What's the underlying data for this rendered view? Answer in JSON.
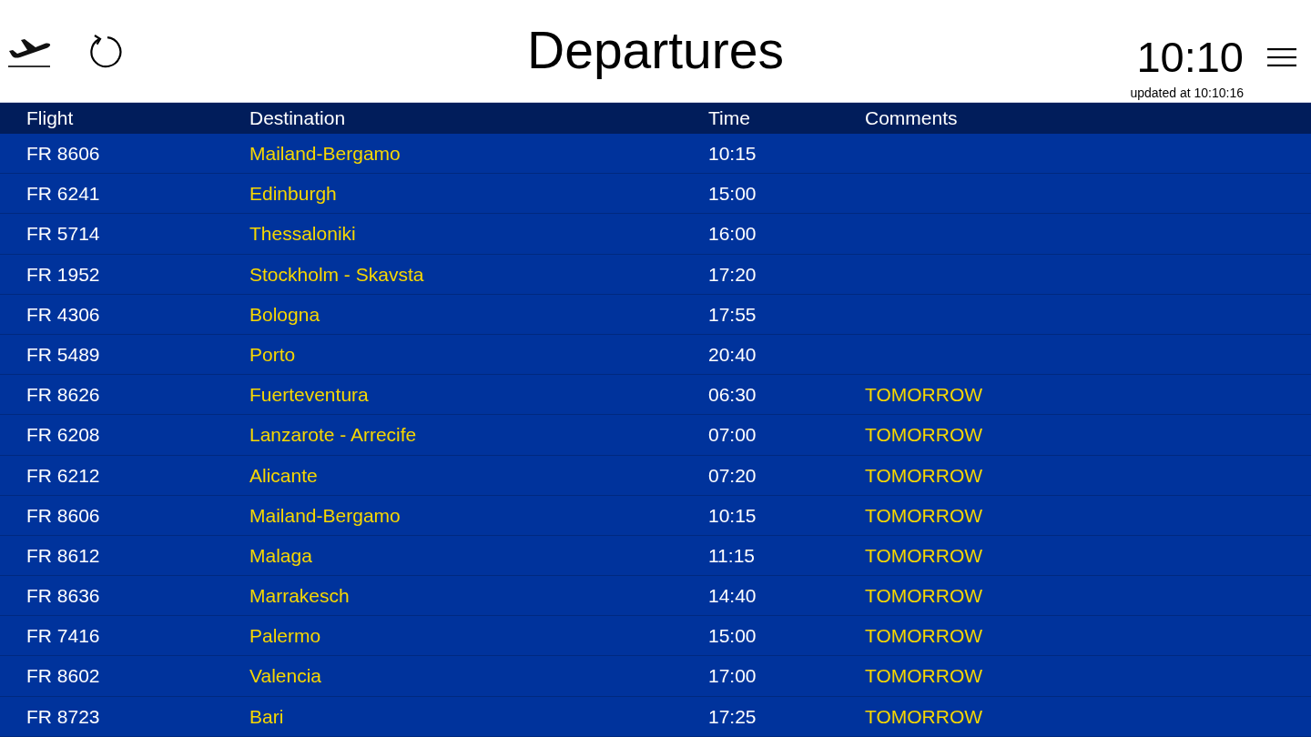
{
  "header": {
    "title": "Departures",
    "clock": "10:10",
    "updated": "updated at 10:10:16"
  },
  "table": {
    "columns": [
      "Flight",
      "Destination",
      "Time",
      "Comments"
    ],
    "rows": [
      {
        "flight": "FR 8606",
        "destination": "Mailand-Bergamo",
        "time": "10:15"
      },
      {
        "flight": "FR 6241",
        "destination": "Edinburgh",
        "time": "15:00"
      },
      {
        "flight": "FR 5714",
        "destination": "Thessaloniki",
        "time": "16:00"
      },
      {
        "flight": "FR 1952",
        "destination": "Stockholm - Skavsta",
        "time": "17:20"
      },
      {
        "flight": "FR 4306",
        "destination": "Bologna",
        "time": "17:55"
      },
      {
        "flight": "FR 5489",
        "destination": "Porto",
        "time": "20:40"
      },
      {
        "flight": "FR 8626",
        "destination": "Fuerteventura",
        "time": "06:30",
        "comment": "TOMORROW"
      },
      {
        "flight": "FR 6208",
        "destination": "Lanzarote - Arrecife",
        "time": "07:00",
        "comment": "TOMORROW"
      },
      {
        "flight": "FR 6212",
        "destination": "Alicante",
        "time": "07:20",
        "comment": "TOMORROW"
      },
      {
        "flight": "FR 8606",
        "destination": "Mailand-Bergamo",
        "time": "10:15",
        "comment": "TOMORROW"
      },
      {
        "flight": "FR 8612",
        "destination": "Malaga",
        "time": "11:15",
        "comment": "TOMORROW"
      },
      {
        "flight": "FR 8636",
        "destination": "Marrakesch",
        "time": "14:40",
        "comment": "TOMORROW"
      },
      {
        "flight": "FR 7416",
        "destination": "Palermo",
        "time": "15:00",
        "comment": "TOMORROW"
      },
      {
        "flight": "FR 8602",
        "destination": "Valencia",
        "time": "17:00",
        "comment": "TOMORROW"
      },
      {
        "flight": "FR 8723",
        "destination": "Bari",
        "time": "17:25",
        "comment": "TOMORROW"
      }
    ]
  }
}
